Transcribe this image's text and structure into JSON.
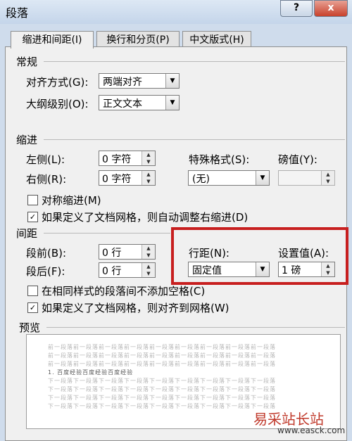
{
  "window": {
    "title": "段落",
    "help_label": "?",
    "close_label": "x"
  },
  "tabs": [
    {
      "label": "缩进和间距(I)",
      "active": true
    },
    {
      "label": "换行和分页(P)",
      "active": false
    },
    {
      "label": "中文版式(H)",
      "active": false
    }
  ],
  "general": {
    "section_label": "常规",
    "alignment_label": "对齐方式(G):",
    "alignment_value": "两端对齐",
    "outline_label": "大纲级别(O):",
    "outline_value": "正文文本"
  },
  "indent": {
    "section_label": "缩进",
    "left_label": "左侧(L):",
    "left_value": "0 字符",
    "right_label": "右侧(R):",
    "right_value": "0 字符",
    "special_label": "特殊格式(S):",
    "special_value": "(无)",
    "by_label": "磅值(Y):",
    "by_value": "",
    "mirror_label": "对称缩进(M)",
    "mirror_checked": false,
    "auto_adjust_label": "如果定义了文档网格，则自动调整右缩进(D)",
    "auto_adjust_checked": true
  },
  "spacing": {
    "section_label": "间距",
    "before_label": "段前(B):",
    "before_value": "0 行",
    "after_label": "段后(F):",
    "after_value": "0 行",
    "line_spacing_label": "行距(N):",
    "line_spacing_value": "固定值",
    "at_label": "设置值(A):",
    "at_value": "1 磅",
    "no_space_label": "在相同样式的段落间不添加空格(C)",
    "no_space_checked": false,
    "snap_grid_label": "如果定义了文档网格，则对齐到网格(W)",
    "snap_grid_checked": true
  },
  "preview": {
    "section_label": "预览",
    "prev_line": "前一段落前一段落前一段落前一段落前一段落前一段落前一段落前一段落前一段落",
    "sample_text": "1. 百度经验百度经验百度经验",
    "next_line": "下一段落下一段落下一段落下一段落下一段落下一段落下一段落下一段落下一段落"
  },
  "watermark": {
    "text": "易采站长站",
    "url": "www.easck.com"
  },
  "icons": {
    "checked": "✓",
    "dropdown": "▼",
    "spin_up": "▲",
    "spin_down": "▼"
  }
}
